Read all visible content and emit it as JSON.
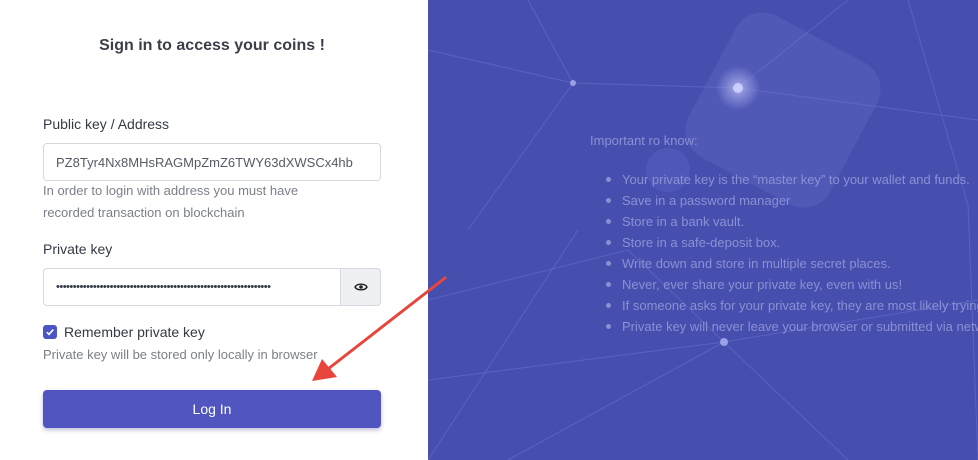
{
  "signin": {
    "title": "Sign in to access your coins !",
    "public_key_label": "Public key / Address",
    "public_key_value": "PZ8Tyr4Nx8MHsRAGMpZmZ6TWY63dXWSCx4hb",
    "public_key_hint_line1": "In order to login with address you must have",
    "public_key_hint_line2": "recorded transaction on blockchain",
    "private_key_label": "Private key",
    "private_key_masked": "••••••••••••••••••••••••••••••••••••••••••••••••••••••••••••••••",
    "remember_label": "Remember private key",
    "remember_checked": true,
    "remember_hint": "Private key will be stored only locally in browser",
    "login_label": "Log In"
  },
  "info": {
    "title": "Important ro know:",
    "items": [
      "Your private key is the “master key” to your wallet and funds.",
      "Save in a password manager",
      "Store in a bank vault.",
      "Store in a safe-deposit box.",
      "Write down and store in multiple secret places.",
      "Never, ever share your private key, even with us!",
      "If someone asks for your private key, they are most likely trying to scam you.",
      "Private key will never leave your browser or submitted via network."
    ]
  },
  "icons": {
    "eye": "eye-icon",
    "checkbox": "checkmark-icon",
    "annotation": "red-arrow"
  },
  "colors": {
    "accent": "#5055bf",
    "panel": "#474fae",
    "annotation": "#e8463c"
  }
}
